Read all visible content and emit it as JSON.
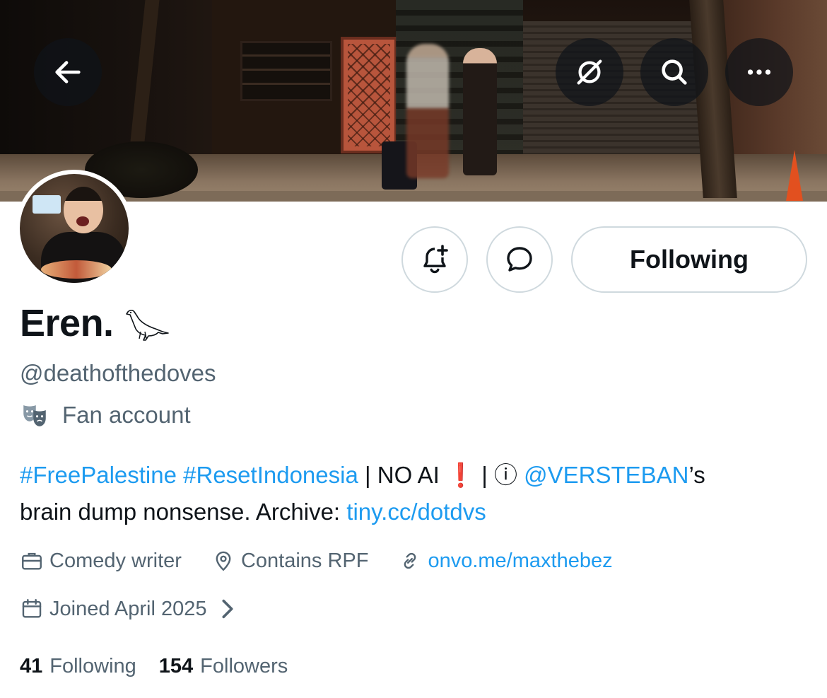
{
  "profile": {
    "display_name": "Eren.",
    "name_emoji": "crow-icon",
    "handle": "@deathofthedoves",
    "label": "Fan account",
    "label_icon": "theater-masks-icon"
  },
  "actions": {
    "following_label": "Following",
    "notify_icon": "bell-plus-icon",
    "message_icon": "message-bubble-icon"
  },
  "nav": {
    "back_icon": "arrow-left-icon",
    "grok_icon": "grok-icon",
    "search_icon": "search-icon",
    "more_icon": "more-dots-icon"
  },
  "bio": {
    "tag1": "#FreePalestine",
    "tag2": "#ResetIndonesia",
    "sep1": " | NO AI ",
    "excl": "❗",
    "sep2": " | ⓘ ",
    "mention": "@VERSTEBAN",
    "mention_suffix": "’s",
    "line2_text": "brain dump nonsense. Archive: ",
    "archive_link": "tiny.cc/dotdvs"
  },
  "meta": {
    "profession": "Comedy writer",
    "location": "Contains RPF",
    "website": "onvo.me/maxthebez",
    "joined": "Joined April 2025"
  },
  "stats": {
    "following_count": "41",
    "following_label": "Following",
    "followers_count": "154",
    "followers_label": "Followers"
  },
  "colors": {
    "link": "#1d9bf0",
    "secondary_text": "#536471",
    "primary_text": "#0f1419",
    "border": "#cfd9de"
  }
}
